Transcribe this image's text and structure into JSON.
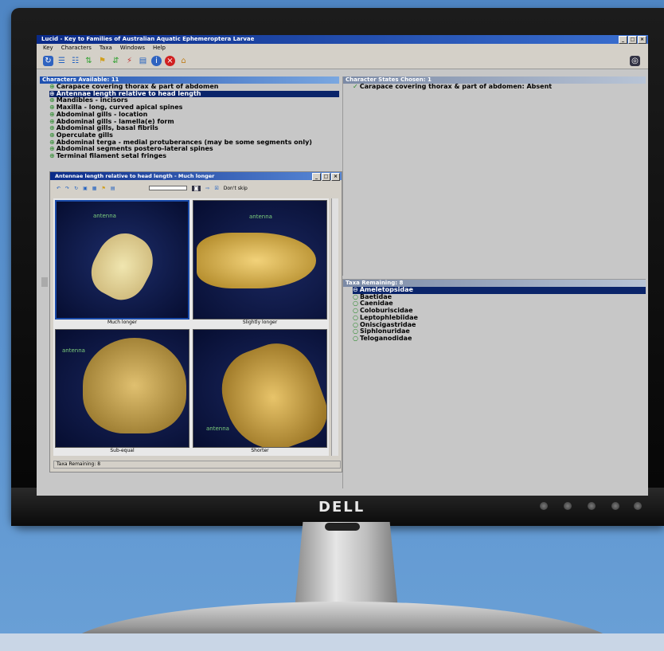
{
  "app": {
    "window_title": "Lucid - Key to Families of Australian Aquatic Ephemeroptera Larvae",
    "menu": [
      "Key",
      "Characters",
      "Taxa",
      "Windows",
      "Help"
    ],
    "monitor_brand": "DELL"
  },
  "characters_panel": {
    "header": "Characters Available: 11",
    "items": [
      "Carapace covering thorax & part of abdomen",
      "Antennae length relative to head length",
      "Mandibles - incisors",
      "Maxilla - long, curved apical spines",
      "Abdominal gills - location",
      "Abdominal gills - lamella(e) form",
      "Abdominal gills, basal fibrils",
      "Operculate gills",
      "Abdominal terga - medial protuberances (may be some segments only)",
      "Abdominal segments postero-lateral spines",
      "Terminal filament setal fringes"
    ],
    "selected_index": 1
  },
  "states_chosen_panel": {
    "header": "Character States Chosen: 1",
    "items": [
      "Carapace covering thorax & part of abdomen: Absent"
    ]
  },
  "taxa_panel": {
    "header": "Taxa Remaining: 8",
    "items": [
      "Ameletopsidae",
      "Baetidae",
      "Caenidae",
      "Coloburiscidae",
      "Leptophlebiidae",
      "Oniscigastridae",
      "Siphlonuridae",
      "Teloganodidae"
    ],
    "selected_index": 0
  },
  "image_window": {
    "title": "Antennae length relative to head length - Much longer",
    "dont_skip_label": "Don't skip",
    "states": [
      {
        "caption": "Much longer",
        "annotation": "antenna"
      },
      {
        "caption": "Slightly longer",
        "annotation": "antenna"
      },
      {
        "caption": "Sub-equal",
        "annotation": "antenna"
      },
      {
        "caption": "Shorter",
        "annotation": "antenna"
      }
    ],
    "status": "Taxa Remaining: 8"
  },
  "colors": {
    "title_bar": "#0a2a88",
    "selection": "#0a246a",
    "tree_icon": "#2a8a2a"
  }
}
